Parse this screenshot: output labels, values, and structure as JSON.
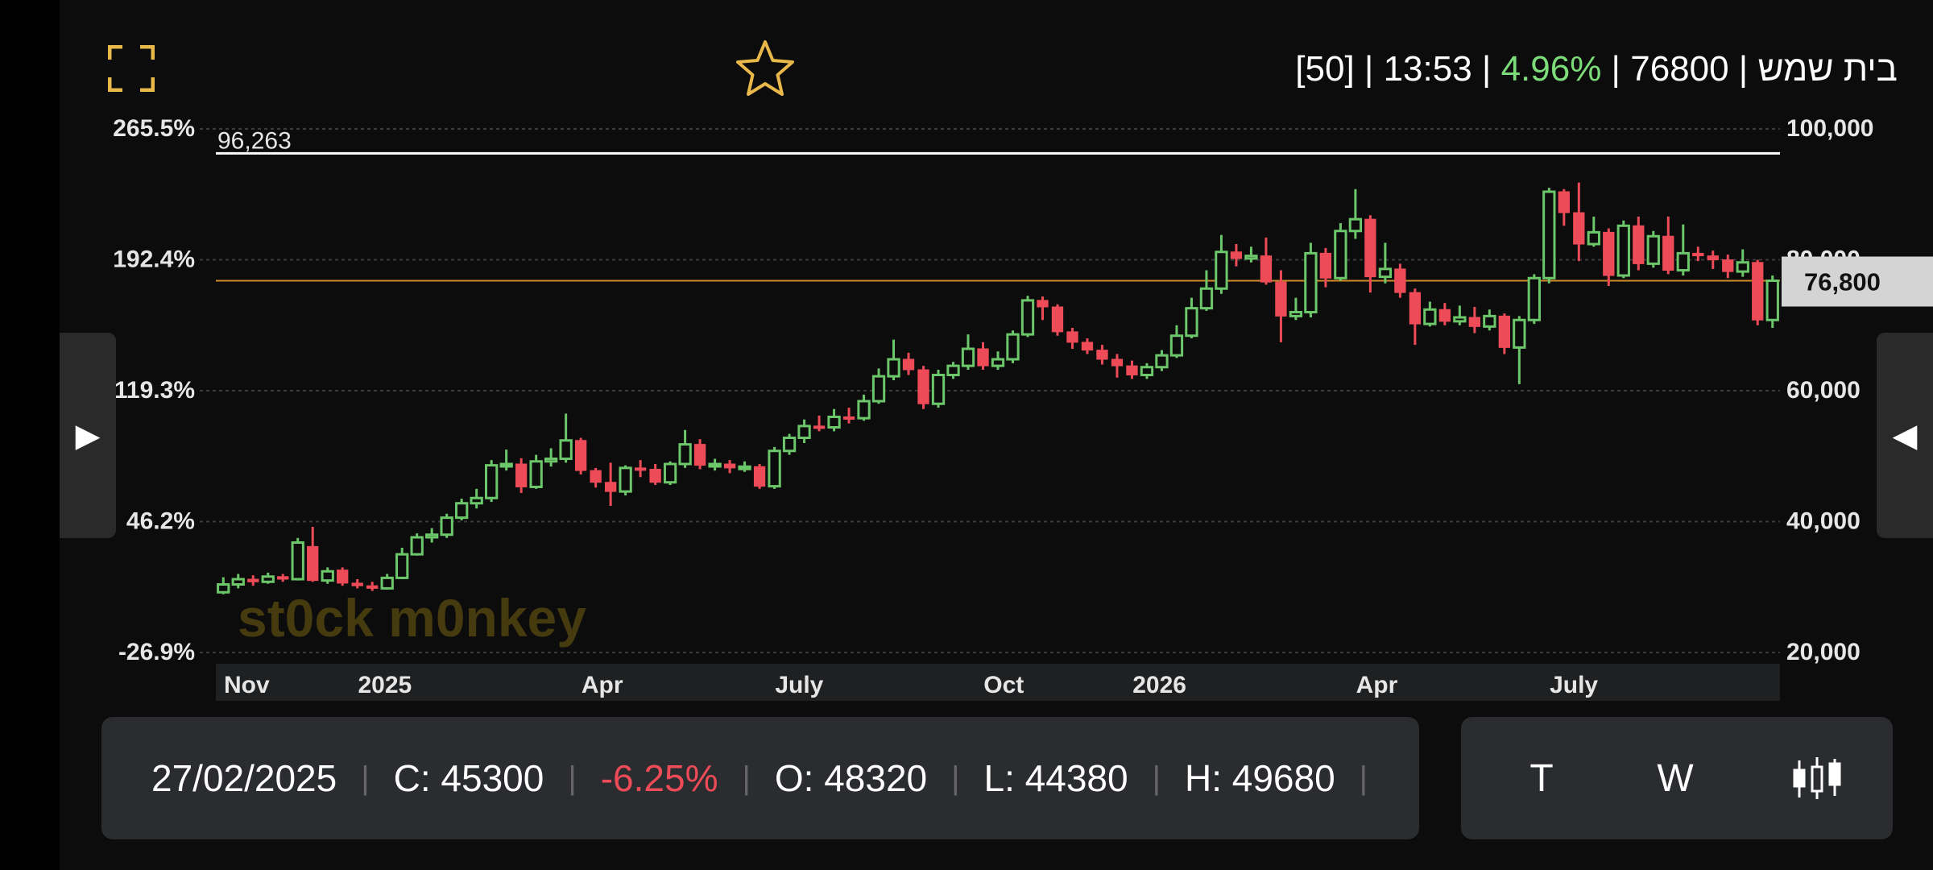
{
  "header": {
    "quote_parts": {
      "bracket": "[50]",
      "time": "13:53",
      "change_pct": "4.96%",
      "price": "76800",
      "name": "בית שמש"
    },
    "sep": " | "
  },
  "icons": {
    "expand": "expand-icon",
    "favorite": "star-outline-icon",
    "prev": "play-right-icon",
    "next": "play-left-icon",
    "candles": "candlestick-icon"
  },
  "colors": {
    "up": "#6cc66a",
    "down": "#ee4b58",
    "accent": "#e8b84a",
    "pct_up": "#7cdc79",
    "marker_line": "#d28a2a",
    "panel": "#2b2c2f"
  },
  "info": {
    "date": "27/02/2025",
    "close": "C: 45300",
    "change": "-6.25%",
    "open": "O: 48320",
    "low": "L: 44380",
    "high": "H: 49680"
  },
  "controls": {
    "t_label": "T",
    "w_label": "W"
  },
  "chart_data": {
    "type": "candlestick",
    "y_right": {
      "min": 20000,
      "max": 100000,
      "ticks": [
        "20,000",
        "40,000",
        "60,000",
        "80,000",
        "100,000"
      ]
    },
    "y_left_ticks": [
      "-26.9%",
      "46.2%",
      "119.3%",
      "192.4%",
      "265.5%"
    ],
    "x_ticks": [
      "Nov",
      "2025",
      "Apr",
      "July",
      "Oct",
      "2026",
      "Apr",
      "July"
    ],
    "x_tick_positions": [
      0,
      9,
      24,
      37,
      51,
      61,
      76,
      89
    ],
    "high_line": {
      "value": 96263,
      "label": "96,263"
    },
    "last_price": {
      "value": 76800,
      "label": "76,800"
    },
    "watermark": "st0ck m0nkey",
    "candles": [
      [
        29200,
        30400,
        31500,
        28900
      ],
      [
        30400,
        31200,
        32000,
        29800
      ],
      [
        31200,
        30800,
        31800,
        30200
      ],
      [
        30800,
        31600,
        32200,
        30500
      ],
      [
        31600,
        31200,
        32000,
        30800
      ],
      [
        31200,
        36800,
        37500,
        31000
      ],
      [
        36200,
        31000,
        39200,
        30800
      ],
      [
        31000,
        32400,
        33000,
        30500
      ],
      [
        32600,
        30600,
        33000,
        30200
      ],
      [
        30600,
        30200,
        31200,
        29800
      ],
      [
        30200,
        29800,
        30800,
        29400
      ],
      [
        29800,
        31400,
        32000,
        29600
      ],
      [
        31400,
        35000,
        36000,
        31200
      ],
      [
        35000,
        37600,
        38200,
        34800
      ],
      [
        37600,
        38000,
        39000,
        36800
      ],
      [
        38000,
        40600,
        41200,
        37500
      ],
      [
        40600,
        42800,
        43500,
        40200
      ],
      [
        42800,
        43600,
        45000,
        42000
      ],
      [
        43600,
        48600,
        49400,
        43000
      ],
      [
        48600,
        48800,
        51000,
        47800
      ],
      [
        48800,
        45300,
        49680,
        44380
      ],
      [
        45300,
        49200,
        50200,
        45000
      ],
      [
        49200,
        49600,
        51200,
        48400
      ],
      [
        49600,
        52400,
        56500,
        49000
      ],
      [
        52400,
        47800,
        52800,
        47200
      ],
      [
        47800,
        46000,
        48200,
        45200
      ],
      [
        46000,
        44600,
        49000,
        42400
      ],
      [
        44600,
        48200,
        48600,
        44000
      ],
      [
        48200,
        48000,
        49400,
        46800
      ],
      [
        48000,
        46000,
        48800,
        45600
      ],
      [
        46000,
        48800,
        49200,
        45600
      ],
      [
        48800,
        51800,
        54000,
        48200
      ],
      [
        51800,
        48600,
        52600,
        48000
      ],
      [
        48600,
        48800,
        49600,
        47800
      ],
      [
        48800,
        48200,
        49400,
        47400
      ],
      [
        48200,
        48400,
        49200,
        47600
      ],
      [
        48400,
        45400,
        48800,
        45000
      ],
      [
        45400,
        50800,
        51400,
        45000
      ],
      [
        50800,
        52800,
        53400,
        50200
      ],
      [
        52800,
        54600,
        55600,
        52000
      ],
      [
        54600,
        54400,
        56200,
        53800
      ],
      [
        54400,
        56000,
        57200,
        53800
      ],
      [
        56000,
        55800,
        57400,
        55000
      ],
      [
        55800,
        58400,
        59400,
        55400
      ],
      [
        58400,
        62200,
        63400,
        58000
      ],
      [
        62200,
        64800,
        67800,
        61600
      ],
      [
        64800,
        63200,
        65800,
        62400
      ],
      [
        63200,
        58000,
        63800,
        57200
      ],
      [
        58000,
        62400,
        63200,
        57400
      ],
      [
        62400,
        63800,
        64400,
        61800
      ],
      [
        63800,
        66400,
        68600,
        63200
      ],
      [
        66400,
        63800,
        67400,
        63200
      ],
      [
        63800,
        64800,
        66000,
        63200
      ],
      [
        64800,
        68600,
        69200,
        64200
      ],
      [
        68600,
        73800,
        74500,
        68200
      ],
      [
        73800,
        72800,
        74400,
        70800
      ],
      [
        72800,
        69000,
        73200,
        68400
      ],
      [
        69000,
        67400,
        69600,
        66400
      ],
      [
        67400,
        66200,
        68000,
        65600
      ],
      [
        66200,
        64800,
        67000,
        64000
      ],
      [
        64800,
        63800,
        65600,
        62000
      ],
      [
        63800,
        62400,
        64600,
        61800
      ],
      [
        62400,
        63600,
        64200,
        61800
      ],
      [
        63600,
        65400,
        66200,
        63000
      ],
      [
        65400,
        68400,
        70000,
        65000
      ],
      [
        68400,
        72600,
        74200,
        68000
      ],
      [
        72600,
        75600,
        78400,
        72200
      ],
      [
        75600,
        81200,
        83800,
        74800
      ],
      [
        81200,
        80200,
        82400,
        79000
      ],
      [
        80200,
        80600,
        82000,
        79600
      ],
      [
        80600,
        76600,
        83400,
        76200
      ],
      [
        76600,
        71400,
        78400,
        67400
      ],
      [
        71400,
        72000,
        74200,
        70800
      ],
      [
        72000,
        81000,
        82600,
        71200
      ],
      [
        81000,
        77200,
        81800,
        75800
      ],
      [
        77200,
        84400,
        85600,
        76800
      ],
      [
        84400,
        86200,
        90800,
        83200
      ],
      [
        86200,
        77400,
        86800,
        75000
      ],
      [
        77400,
        78600,
        82600,
        76400
      ],
      [
        78600,
        75000,
        79400,
        74200
      ],
      [
        75000,
        70200,
        75600,
        67000
      ],
      [
        70200,
        72400,
        73600,
        69800
      ],
      [
        72400,
        70600,
        73400,
        70000
      ],
      [
        70600,
        71200,
        73000,
        70000
      ],
      [
        71200,
        69800,
        72800,
        68800
      ],
      [
        69800,
        71400,
        72400,
        69200
      ],
      [
        71400,
        66600,
        71800,
        65600
      ],
      [
        66600,
        70800,
        71400,
        61000
      ],
      [
        70800,
        77200,
        77800,
        70200
      ],
      [
        77200,
        90400,
        91000,
        76400
      ],
      [
        90400,
        87200,
        90800,
        85200
      ],
      [
        87200,
        82400,
        91800,
        79800
      ],
      [
        82400,
        84200,
        86600,
        82000
      ],
      [
        84200,
        77600,
        84800,
        76000
      ],
      [
        77600,
        85200,
        86000,
        77200
      ],
      [
        85200,
        79400,
        86600,
        78400
      ],
      [
        79400,
        83600,
        84400,
        78800
      ],
      [
        83600,
        78400,
        86600,
        77800
      ],
      [
        78400,
        81000,
        85400,
        77600
      ],
      [
        81000,
        80600,
        82000,
        79800
      ],
      [
        80600,
        80000,
        81400,
        78600
      ],
      [
        80000,
        78200,
        80800,
        77200
      ],
      [
        78200,
        79600,
        81600,
        77400
      ],
      [
        79600,
        70800,
        80000,
        70000
      ],
      [
        70800,
        76800,
        77600,
        69600
      ]
    ]
  }
}
